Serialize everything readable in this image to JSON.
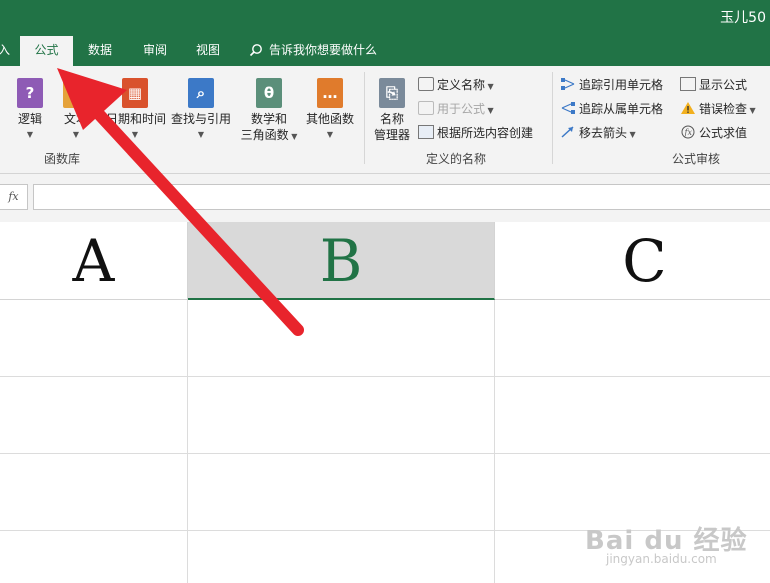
{
  "window": {
    "title": "玉儿50"
  },
  "tabs": [
    {
      "label": "插入"
    },
    {
      "label": "公式",
      "active": true
    },
    {
      "label": "数据"
    },
    {
      "label": "审阅"
    },
    {
      "label": "视图"
    }
  ],
  "tell_me": "告诉我你想要做什么",
  "ribbon": {
    "function_library": {
      "label": "函数库",
      "logical": "逻辑",
      "text": "文本",
      "datetime": "日期和时间",
      "lookup": "查找与引用",
      "math_line1": "数学和",
      "math_line2": "三角函数",
      "more": "其他函数"
    },
    "defined_names": {
      "label": "定义的名称",
      "name_manager_line1": "名称",
      "name_manager_line2": "管理器",
      "define_name": "定义名称",
      "use_in_formula": "用于公式",
      "create_from_selection": "根据所选内容创建"
    },
    "formula_auditing": {
      "label": "公式审核",
      "trace_precedents": "追踪引用单元格",
      "trace_dependents": "追踪从属单元格",
      "remove_arrows": "移去箭头",
      "show_formulas": "显示公式",
      "error_checking": "错误检查",
      "evaluate_formula": "公式求值"
    }
  },
  "formula_bar": {
    "fx": "fx",
    "value": ""
  },
  "columns": [
    "A",
    "B",
    "C"
  ],
  "selected_column": "B",
  "watermark": {
    "brand": "Bai du 经验",
    "url": "jingyan.baidu.com"
  },
  "colors": {
    "excel_green": "#217346",
    "arrow_red": "#e8242c"
  }
}
